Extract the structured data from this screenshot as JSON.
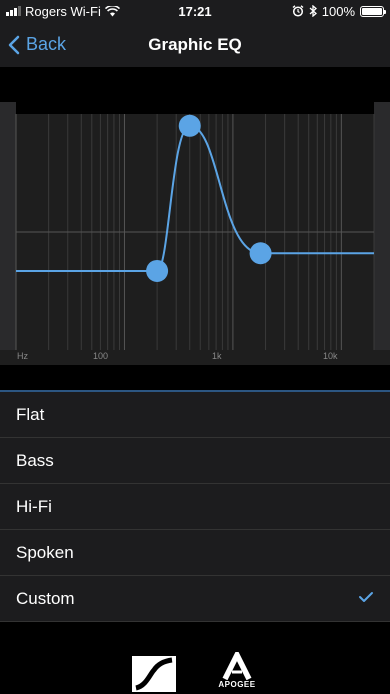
{
  "status_bar": {
    "carrier": "Rogers Wi-Fi",
    "time": "17:21",
    "battery": "100%",
    "battery_level": 1.0,
    "icons": [
      "signal-icon",
      "wifi-icon",
      "alarm-icon",
      "bluetooth-icon",
      "battery-icon"
    ]
  },
  "nav": {
    "back_label": "Back",
    "title": "Graphic EQ"
  },
  "eq": {
    "axis_labels": [
      "Hz",
      "100",
      "1k",
      "10k"
    ],
    "accent_color": "#5ba4e5",
    "handles": [
      {
        "freq": 200,
        "level": -0.33
      },
      {
        "freq": 400,
        "level": 0.9
      },
      {
        "freq": 1800,
        "level": -0.18
      }
    ]
  },
  "presets": [
    {
      "label": "Flat",
      "selected": false
    },
    {
      "label": "Bass",
      "selected": false
    },
    {
      "label": "Hi-Fi",
      "selected": false
    },
    {
      "label": "Spoken",
      "selected": false
    },
    {
      "label": "Custom",
      "selected": true
    }
  ],
  "footer": {
    "logos": [
      "sennheiser-logo",
      "apogee-logo"
    ],
    "apogee_text": "APOGEE"
  }
}
